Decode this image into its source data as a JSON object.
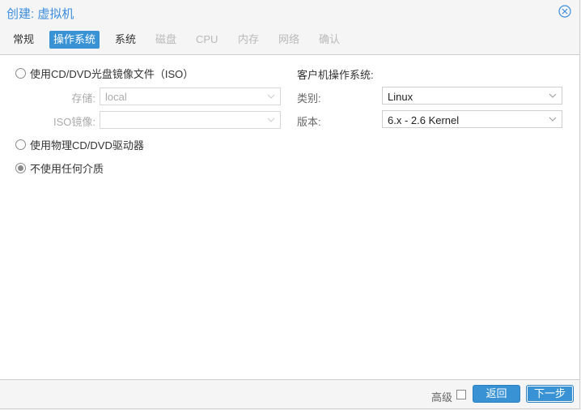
{
  "window": {
    "title": "创建: 虚拟机",
    "close_icon": "close-circle-icon"
  },
  "tabs": [
    {
      "label": "常规",
      "state": "normal"
    },
    {
      "label": "操作系统",
      "state": "active"
    },
    {
      "label": "系统",
      "state": "normal"
    },
    {
      "label": "磁盘",
      "state": "disabled"
    },
    {
      "label": "CPU",
      "state": "disabled"
    },
    {
      "label": "内存",
      "state": "disabled"
    },
    {
      "label": "网络",
      "state": "disabled"
    },
    {
      "label": "确认",
      "state": "disabled"
    }
  ],
  "media": {
    "option_iso": {
      "label": "使用CD/DVD光盘镜像文件（ISO）",
      "checked": false
    },
    "storage": {
      "label": "存储:",
      "value": "local",
      "disabled": true
    },
    "iso_image": {
      "label": "ISO镜像:",
      "value": "",
      "disabled": true
    },
    "option_physical": {
      "label": "使用物理CD/DVD驱动器",
      "checked": false
    },
    "option_none": {
      "label": "不使用任何介质",
      "checked": true
    }
  },
  "guest_os": {
    "heading": "客户机操作系统:",
    "type": {
      "label": "类别:",
      "value": "Linux"
    },
    "version": {
      "label": "版本:",
      "value": "6.x - 2.6 Kernel"
    }
  },
  "footer": {
    "advanced_label": "高级",
    "advanced_checked": false,
    "back_label": "返回",
    "next_label": "下一步"
  },
  "colors": {
    "accent": "#3892d4",
    "title": "#3c8dde",
    "disabled_text": "#b9b9b9"
  }
}
